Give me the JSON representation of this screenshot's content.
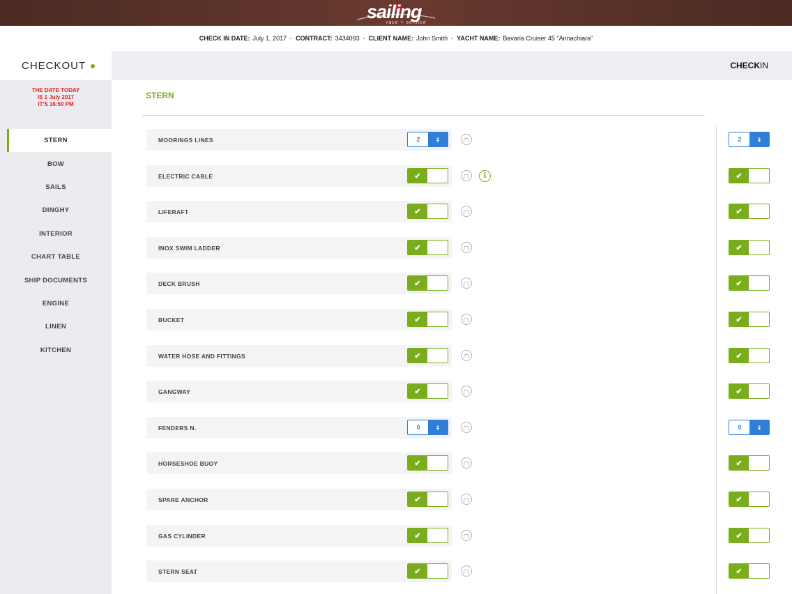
{
  "brand": {
    "logo_text": "sailing",
    "logo_subtext": "race + service"
  },
  "info_bar": {
    "check_in_date_label": "CHECK IN DATE:",
    "check_in_date": "July 1, 2017",
    "contract_label": "CONTRACT:",
    "contract": "3434093",
    "client_name_label": "CLIENT NAME:",
    "client_name": "John Smith",
    "yacht_name_label": "YACHT NAME:",
    "yacht_name": "Bavaria Cruiser 45 \"Annachiara\"",
    "separator": "-"
  },
  "header": {
    "checkout_label": "CHECKOUT",
    "checkin_bold": "CHECK",
    "checkin_thin": "IN"
  },
  "sidebar": {
    "today_line1": "THE DATE TODAY",
    "today_line2": "IS 1 July 2017",
    "today_line3": "IT'S 16:50 PM",
    "items": [
      {
        "label": "STERN"
      },
      {
        "label": "BOW"
      },
      {
        "label": "SAILS"
      },
      {
        "label": "DINGHY"
      },
      {
        "label": "INTERIOR"
      },
      {
        "label": "CHART TABLE"
      },
      {
        "label": "SHIP DOCUMENTS"
      },
      {
        "label": "ENGINE"
      },
      {
        "label": "LINEN"
      },
      {
        "label": "KITCHEN"
      }
    ]
  },
  "section": {
    "title": "STERN",
    "check_mark": "✔",
    "info_mark": "i",
    "rows": [
      {
        "label": "MOORINGS LINES",
        "type": "stepper",
        "checkout_value": "2",
        "checkin_value": "2"
      },
      {
        "label": "ELECTRIC CABLE",
        "type": "toggle",
        "checkout_on": true,
        "checkin_on": true,
        "has_info": true
      },
      {
        "label": "LIFERAFT",
        "type": "toggle",
        "checkout_on": true,
        "checkin_on": true
      },
      {
        "label": "INOX SWIM LADDER",
        "type": "toggle",
        "checkout_on": true,
        "checkin_on": true
      },
      {
        "label": "DECK BRUSH",
        "type": "toggle",
        "checkout_on": true,
        "checkin_on": true
      },
      {
        "label": "BUCKET",
        "type": "toggle",
        "checkout_on": true,
        "checkin_on": true
      },
      {
        "label": "WATER HOSE AND FITTINGS",
        "type": "toggle",
        "checkout_on": true,
        "checkin_on": true
      },
      {
        "label": "GANGWAY",
        "type": "toggle",
        "checkout_on": true,
        "checkin_on": true
      },
      {
        "label": "FENDERS N.",
        "type": "stepper",
        "checkout_value": "0",
        "checkin_value": "0"
      },
      {
        "label": "HORSESHOE BUOY",
        "type": "toggle",
        "checkout_on": true,
        "checkin_on": true
      },
      {
        "label": "SPARE ANCHOR",
        "type": "toggle",
        "checkout_on": true,
        "checkin_on": true
      },
      {
        "label": "GAS CYLINDER",
        "type": "toggle",
        "checkout_on": true,
        "checkin_on": true
      },
      {
        "label": "STERN SEAT",
        "type": "toggle",
        "checkout_on": true,
        "checkin_on": true
      }
    ]
  },
  "colors": {
    "accent_green": "#7aad1b",
    "stepper_blue": "#2f7fd8",
    "date_red": "#e02020",
    "brand_bar": "#5a3228"
  }
}
